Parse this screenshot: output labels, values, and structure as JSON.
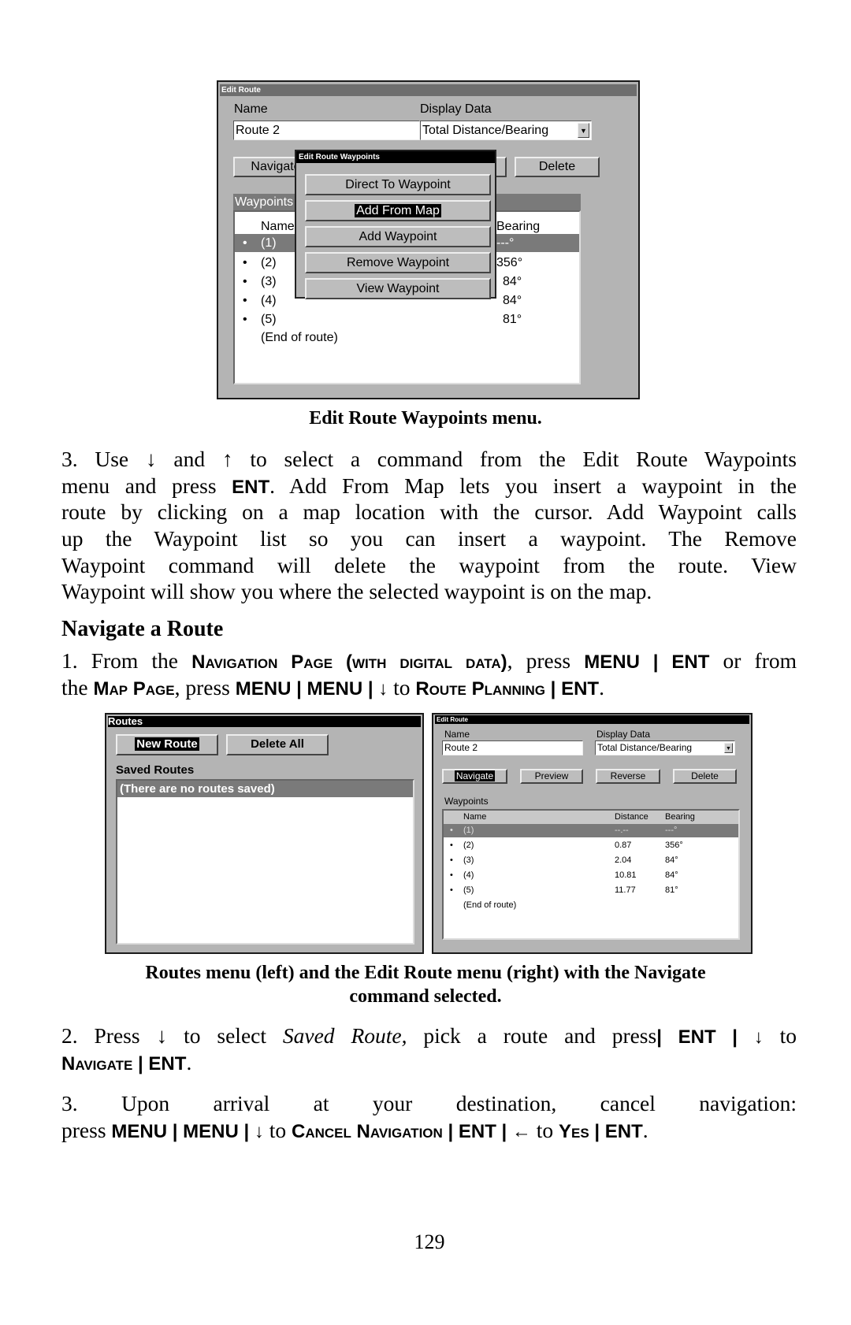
{
  "top_screen": {
    "title": "Edit Route",
    "name_label": "Name",
    "name_value": "Route 2",
    "display_label": "Display Data",
    "display_value": "Total Distance/Bearing",
    "buttons": [
      "Navigate",
      "Delete"
    ],
    "waypoints_label": "Waypoints",
    "col_name": "Name",
    "col_bearing": "Bearing",
    "rows": [
      {
        "name": "(1)",
        "bearing": "---°"
      },
      {
        "name": "(2)",
        "bearing": "356°"
      },
      {
        "name": "(3)",
        "bearing": "84°"
      },
      {
        "name": "(4)",
        "bearing": "84°"
      },
      {
        "name": "(5)",
        "bearing": "81°"
      }
    ],
    "end_label": "(End of route)",
    "popup": {
      "title": "Edit Route Waypoints",
      "items": [
        "Direct To Waypoint",
        "Add From Map",
        "Add Waypoint",
        "Remove Waypoint",
        "View Waypoint"
      ],
      "selected": "Add From Map"
    }
  },
  "caption1": "Edit Route Waypoints menu.",
  "step3_lines": [
    [
      [
        "3. Use ↓ and ↑ to select a command from the Edit Route Waypoints",
        "n"
      ]
    ],
    [
      [
        "menu and press ",
        "n"
      ],
      [
        "ENT",
        "k"
      ],
      [
        ". Add From Map lets you insert a waypoint in the",
        "n"
      ]
    ],
    [
      [
        "route by clicking on a map location with the cursor. Add Waypoint calls",
        "n"
      ]
    ],
    [
      [
        "up the Waypoint list so you can insert a waypoint. The Remove",
        "n"
      ]
    ],
    [
      [
        "Waypoint command will delete the waypoint from the route. View",
        "n"
      ]
    ],
    [
      [
        "Waypoint will show you where the selected waypoint is on the map.",
        "n"
      ]
    ]
  ],
  "heading": "Navigate a Route",
  "step1_lines": [
    [
      [
        "1. From the ",
        "n"
      ],
      [
        "Navigation Page (with digital data)",
        "sc"
      ],
      [
        ", press ",
        "n"
      ],
      [
        "MENU | ENT",
        "k"
      ],
      [
        " or from",
        "n"
      ]
    ],
    [
      [
        "the ",
        "n"
      ],
      [
        "Map Page",
        "sc"
      ],
      [
        ", press ",
        "n"
      ],
      [
        "MENU | MENU | ↓",
        "k"
      ],
      [
        " to ",
        "n"
      ],
      [
        "Route Planning",
        "sc"
      ],
      [
        " | ENT",
        "k"
      ],
      [
        ".",
        "n"
      ]
    ]
  ],
  "routes_screen": {
    "title": "Routes",
    "new_route": "New Route",
    "delete_all": "Delete All",
    "saved_label": "Saved Routes",
    "empty_text": "(There are no routes saved)"
  },
  "edit_screen": {
    "title": "Edit Route",
    "name_label": "Name",
    "name_value": "Route 2",
    "display_label": "Display Data",
    "display_value": "Total Distance/Bearing",
    "buttons": [
      "Navigate",
      "Preview",
      "Reverse",
      "Delete"
    ],
    "selected_button": "Navigate",
    "waypoints_label": "Waypoints",
    "col_name": "Name",
    "col_distance": "Distance",
    "col_bearing": "Bearing",
    "rows": [
      {
        "name": "(1)",
        "distance": "--.--",
        "bearing": "---°"
      },
      {
        "name": "(2)",
        "distance": "0.87",
        "bearing": "356°"
      },
      {
        "name": "(3)",
        "distance": "2.04",
        "bearing": "84°"
      },
      {
        "name": "(4)",
        "distance": "10.81",
        "bearing": "84°"
      },
      {
        "name": "(5)",
        "distance": "11.77",
        "bearing": "81°"
      }
    ],
    "end_label": "(End of route)"
  },
  "caption2_lines": [
    "Routes menu (left) and the Edit Route menu (right) with the Navigate",
    "command selected."
  ],
  "step2_lines": [
    [
      [
        "2. Press ↓ to select ",
        "n"
      ],
      [
        "Saved Route,",
        "i"
      ],
      [
        " pick a route and press",
        "n"
      ],
      [
        "| ENT | ↓",
        "k"
      ],
      [
        " to",
        "n"
      ]
    ],
    [
      [
        "Navigate",
        "sc"
      ],
      [
        " | ENT",
        "k"
      ],
      [
        ".",
        "n"
      ]
    ]
  ],
  "step3b_lines": [
    [
      [
        "3. Upon arrival at your destination, cancel navigation:",
        "n"
      ]
    ],
    [
      [
        "press ",
        "n"
      ],
      [
        "MENU | MENU | ↓",
        "k"
      ],
      [
        " to ",
        "n"
      ],
      [
        "Cancel Navigation",
        "sc"
      ],
      [
        " | ENT | ←",
        "k"
      ],
      [
        " to ",
        "n"
      ],
      [
        "Yes",
        "sc"
      ],
      [
        " | ENT",
        "k"
      ],
      [
        ".",
        "n"
      ]
    ]
  ],
  "page_number": "129",
  "colors": {
    "screen_bg": "#b4b4b4",
    "title_bar_dark": "#000000",
    "title_bar_gray": "#6e6e6e",
    "highlight_row": "#7a7a7a"
  }
}
